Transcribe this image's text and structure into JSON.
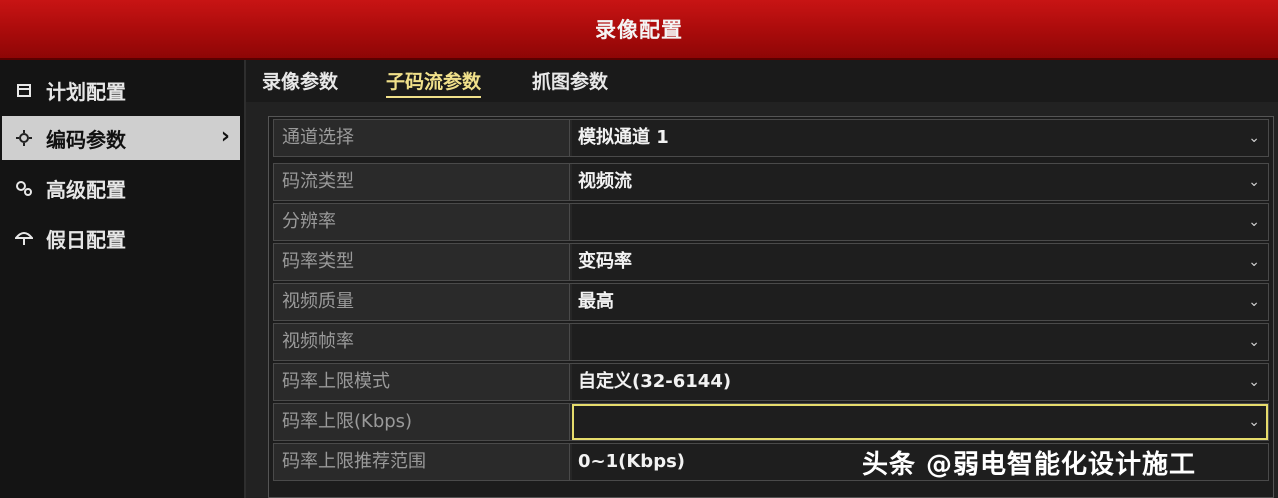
{
  "window": {
    "title": "录像配置"
  },
  "sidebar": {
    "items": [
      {
        "label": "计划配置",
        "icon": "calendar-icon"
      },
      {
        "label": "编码参数",
        "icon": "gear-icon",
        "active": true
      },
      {
        "label": "高级配置",
        "icon": "gears-icon"
      },
      {
        "label": "假日配置",
        "icon": "umbrella-icon"
      }
    ],
    "active_chevron": "›"
  },
  "tabs": [
    {
      "label": "录像参数"
    },
    {
      "label": "子码流参数",
      "active": true
    },
    {
      "label": "抓图参数"
    }
  ],
  "form": {
    "rows": [
      {
        "label": "通道选择",
        "value": "模拟通道 1"
      },
      {
        "label": "码流类型",
        "value": "视频流"
      },
      {
        "label": "分辨率",
        "value": ""
      },
      {
        "label": "码率类型",
        "value": "变码率"
      },
      {
        "label": "视频质量",
        "value": "最高"
      },
      {
        "label": "视频帧率",
        "value": ""
      },
      {
        "label": "码率上限模式",
        "value": "自定义(32-6144)"
      },
      {
        "label": "码率上限(Kbps)",
        "value": ""
      },
      {
        "label": "码率上限推荐范围",
        "value": "0~1(Kbps)"
      }
    ],
    "dropdown_arrow": "⌄"
  },
  "watermark": "头条 @弱电智能化设计施工",
  "colors": {
    "title_bar": "#b30d0d",
    "active_tab": "#f0e08a",
    "focus_outline": "#e6dc6c"
  }
}
